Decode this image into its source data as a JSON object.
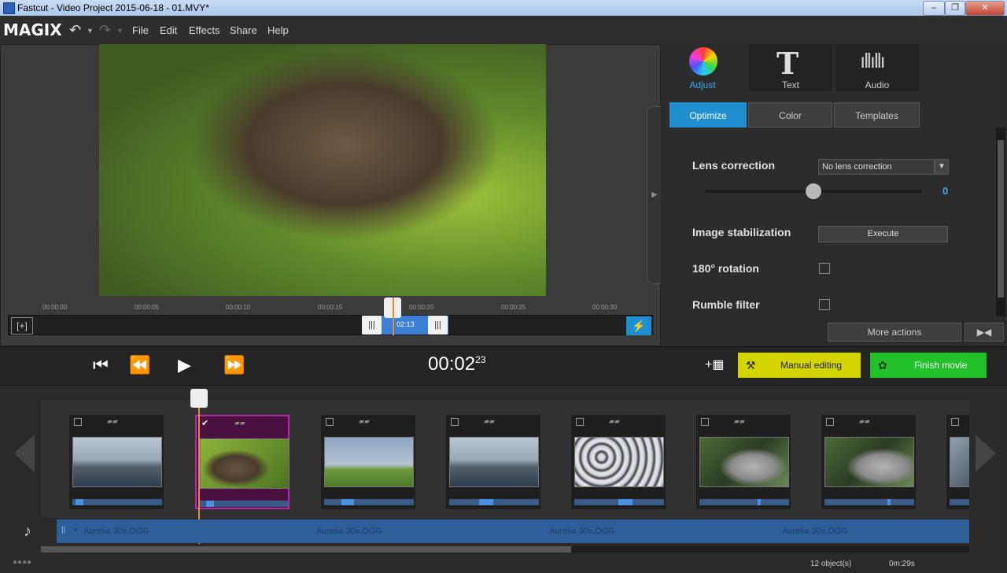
{
  "window": {
    "title": "Fastcut - Video Project 2015-06-18 - 01.MVY*"
  },
  "menu": {
    "logo": "MAGIX",
    "items": [
      "File",
      "Edit",
      "Effects",
      "Share",
      "Help"
    ]
  },
  "preview": {
    "ruler_ticks": [
      "00:00:00",
      "00:00:05",
      "00:00:10",
      "00:00:15",
      "00:00:20",
      "00:00:25",
      "00:00:30"
    ],
    "clip_time": "02:13"
  },
  "panel": {
    "tabs": [
      "Adjust",
      "Text",
      "Audio"
    ],
    "subtabs": [
      "Optimize",
      "Color",
      "Templates"
    ],
    "lens_label": "Lens correction",
    "lens_value": "No lens correction",
    "slider_value": "0",
    "stabilization_label": "Image stabilization",
    "execute_label": "Execute",
    "rotation_label": "180° rotation",
    "rumble_label": "Rumble filter",
    "more_actions": "More actions"
  },
  "transport": {
    "timecode": "00:02",
    "frames": "23",
    "manual_editing": "Manual editing",
    "finish_movie": "Finish movie"
  },
  "storyboard": {
    "audio_labels": [
      "Aurelia 30s.OGG",
      "Aurelia 30s.OGG",
      "Aurelia 30s.OGG",
      "Aurelia 30s.OGG"
    ]
  },
  "status": {
    "objects": "12 object(s)",
    "duration": "0m:29s"
  },
  "colors": {
    "accent": "#1f8fd0",
    "manual": "#d4d400",
    "finish": "#22c22a",
    "selection": "#b42aa8"
  }
}
